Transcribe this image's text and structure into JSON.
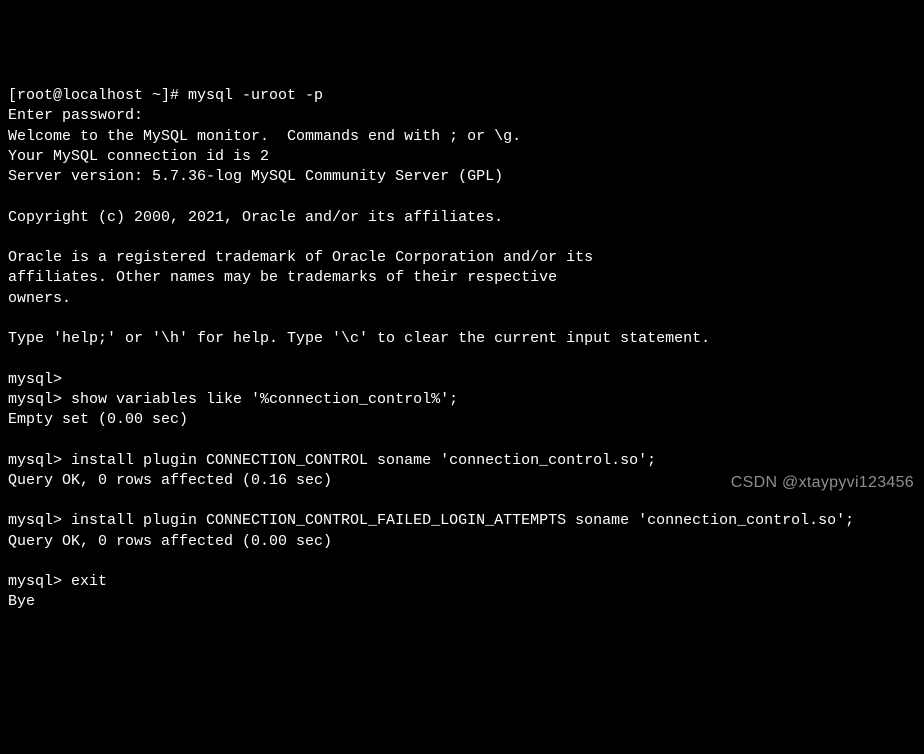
{
  "terminal": {
    "lines": [
      "[root@localhost ~]# mysql -uroot -p",
      "Enter password:",
      "Welcome to the MySQL monitor.  Commands end with ; or \\g.",
      "Your MySQL connection id is 2",
      "Server version: 5.7.36-log MySQL Community Server (GPL)",
      "",
      "Copyright (c) 2000, 2021, Oracle and/or its affiliates.",
      "",
      "Oracle is a registered trademark of Oracle Corporation and/or its",
      "affiliates. Other names may be trademarks of their respective",
      "owners.",
      "",
      "Type 'help;' or '\\h' for help. Type '\\c' to clear the current input statement.",
      "",
      "mysql>",
      "mysql> show variables like '%connection_control%';",
      "Empty set (0.00 sec)",
      "",
      "mysql> install plugin CONNECTION_CONTROL soname 'connection_control.so';",
      "Query OK, 0 rows affected (0.16 sec)",
      "",
      "mysql> install plugin CONNECTION_CONTROL_FAILED_LOGIN_ATTEMPTS soname 'connection_control.so';",
      "Query OK, 0 rows affected (0.00 sec)",
      "",
      "mysql> exit",
      "Bye"
    ]
  },
  "watermark": "CSDN @xtaypyvi123456"
}
